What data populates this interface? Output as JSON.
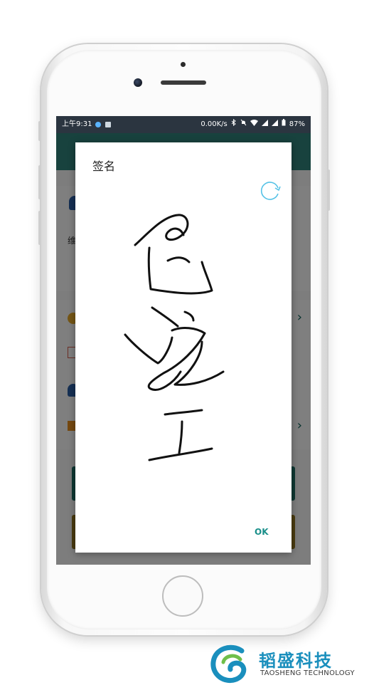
{
  "status_bar": {
    "time": "上午9:31",
    "network_speed": "0.00K/s",
    "battery": "87%",
    "icons": [
      "bluetooth-icon",
      "mute-icon",
      "wifi-icon",
      "signal-icon",
      "signal-icon",
      "battery-icon"
    ]
  },
  "background_app": {
    "partial_text": "维",
    "chevron": "›"
  },
  "dialog": {
    "title": "签名",
    "refresh_icon": "refresh-icon",
    "ok_label": "OK",
    "signature": "handwritten signature"
  },
  "brand": {
    "name_cn": "韬盛科技",
    "name_en": "TAOSHENG TECHNOLOGY",
    "colors": {
      "blue": "#1a8fbd",
      "green": "#6fbf4a"
    }
  },
  "colors": {
    "accent": "#1a8f8a",
    "refresh": "#55c2e6",
    "status_bar": "#2b3540"
  }
}
